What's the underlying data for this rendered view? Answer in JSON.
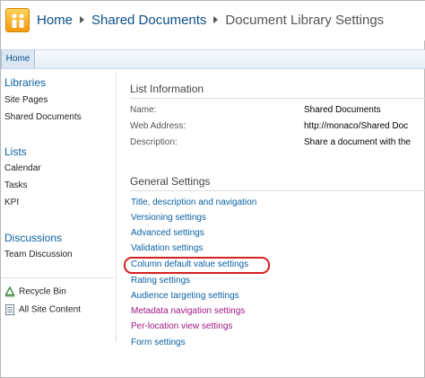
{
  "breadcrumb": {
    "home": "Home",
    "library": "Shared Documents",
    "current": "Document Library Settings"
  },
  "topnav": {
    "home_tab": "Home"
  },
  "leftnav": {
    "libraries": {
      "heading": "Libraries",
      "items": [
        "Site Pages",
        "Shared Documents"
      ]
    },
    "lists": {
      "heading": "Lists",
      "items": [
        "Calendar",
        "Tasks",
        "KPI"
      ]
    },
    "discussions": {
      "heading": "Discussions",
      "items": [
        "Team Discussion"
      ]
    },
    "recycle_bin": "Recycle Bin",
    "all_site_content": "All Site Content"
  },
  "list_information": {
    "title": "List Information",
    "name_label": "Name:",
    "name_value": "Shared Documents",
    "web_label": "Web Address:",
    "web_value": "http://monaco/Shared Doc",
    "desc_label": "Description:",
    "desc_value": "Share a document with the"
  },
  "general_settings": {
    "title": "General Settings",
    "links": [
      "Title, description and navigation",
      "Versioning settings",
      "Advanced settings",
      "Validation settings",
      "Column default value settings",
      "Rating settings",
      "Audience targeting settings",
      "Metadata navigation settings",
      "Per-location view settings",
      "Form settings"
    ]
  },
  "colors": {
    "link": "#0b61a4",
    "metadata_link": "#a01a86",
    "highlight": "#d32020"
  },
  "icons": {
    "logo": "sharepoint-logo-icon",
    "recycle": "recycle-bin-icon",
    "site_content": "all-site-content-icon"
  }
}
